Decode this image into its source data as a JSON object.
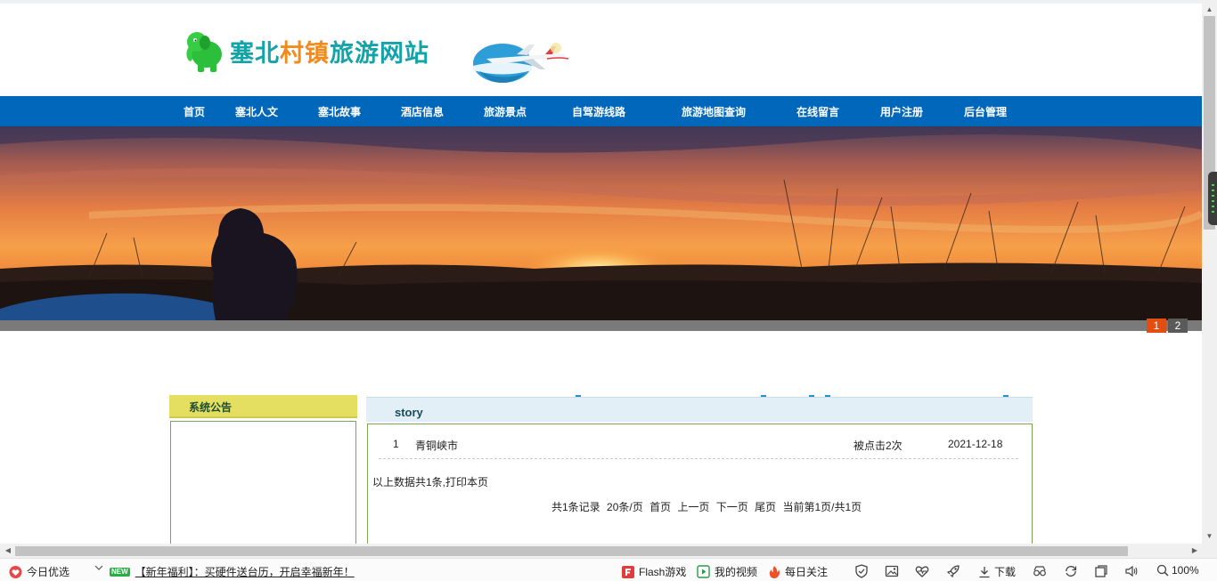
{
  "site": {
    "title": "塞北村镇旅游网站",
    "colors": {
      "title_teal": "#14a3a9",
      "title_orange": "#f08c1e",
      "nav_bg": "#0067bb",
      "slider_active": "#e24d10"
    }
  },
  "nav": {
    "items": [
      {
        "label": "首页"
      },
      {
        "label": "塞北人文"
      },
      {
        "label": "塞北故事"
      },
      {
        "label": "酒店信息"
      },
      {
        "label": "旅游景点"
      },
      {
        "label": "自驾游线路"
      },
      {
        "label": "旅游地图查询"
      },
      {
        "label": "在线留言"
      },
      {
        "label": "用户注册"
      },
      {
        "label": "后台管理"
      }
    ]
  },
  "banner": {
    "slides": [
      "1",
      "2"
    ],
    "active_slide": "1"
  },
  "sidebar": {
    "title": "系统公告"
  },
  "main": {
    "section_title": "story",
    "rows": [
      {
        "index": "1",
        "title": "青铜峡市",
        "clicks": "被点击2次",
        "date": "2021-12-18"
      }
    ],
    "summary_prefix": "以上数据共1条,",
    "print_link": "打印本页",
    "pager": {
      "total": "共1条记录",
      "per_page": "20条/页",
      "first": "首页",
      "prev": "上一页",
      "next": "下一页",
      "last": "尾页",
      "current": "当前第1页/共1页"
    }
  },
  "statusbar": {
    "today_pick": "今日优选",
    "new_badge": "NEW",
    "news_text": "【新年福利】：买硬件送台历，开启幸福新年！",
    "flash_games": "Flash游戏",
    "my_videos": "我的视频",
    "daily_follow": "每日关注",
    "download": "下载",
    "zoom": "100%",
    "icons": [
      "heart-icon",
      "chevron-down-icon",
      "flash-game-icon",
      "video-play-icon",
      "fire-icon",
      "shield-icon",
      "image-icon",
      "health-heart-icon",
      "rocket-icon",
      "download-icon",
      "glasses-icon",
      "refresh-icon",
      "window-icon",
      "speaker-icon",
      "zoom-icon"
    ]
  }
}
